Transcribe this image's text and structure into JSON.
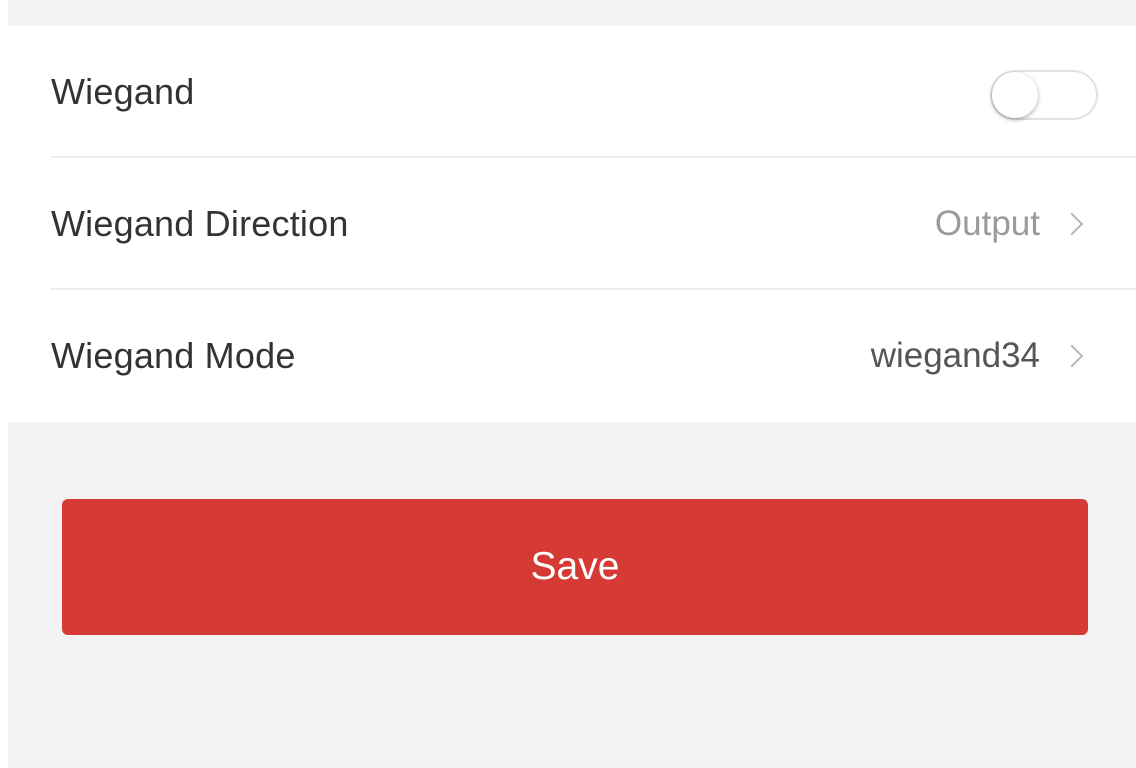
{
  "settings": {
    "wiegand": {
      "label": "Wiegand",
      "enabled": false
    },
    "wiegand_direction": {
      "label": "Wiegand Direction",
      "value": "Output",
      "icon": "chevron-right-icon"
    },
    "wiegand_mode": {
      "label": "Wiegand Mode",
      "value": "wiegand34",
      "icon": "chevron-right-icon"
    }
  },
  "actions": {
    "save_label": "Save"
  },
  "colors": {
    "accent": "#d63a34",
    "background": "#f2f2f2",
    "card": "#ffffff"
  }
}
